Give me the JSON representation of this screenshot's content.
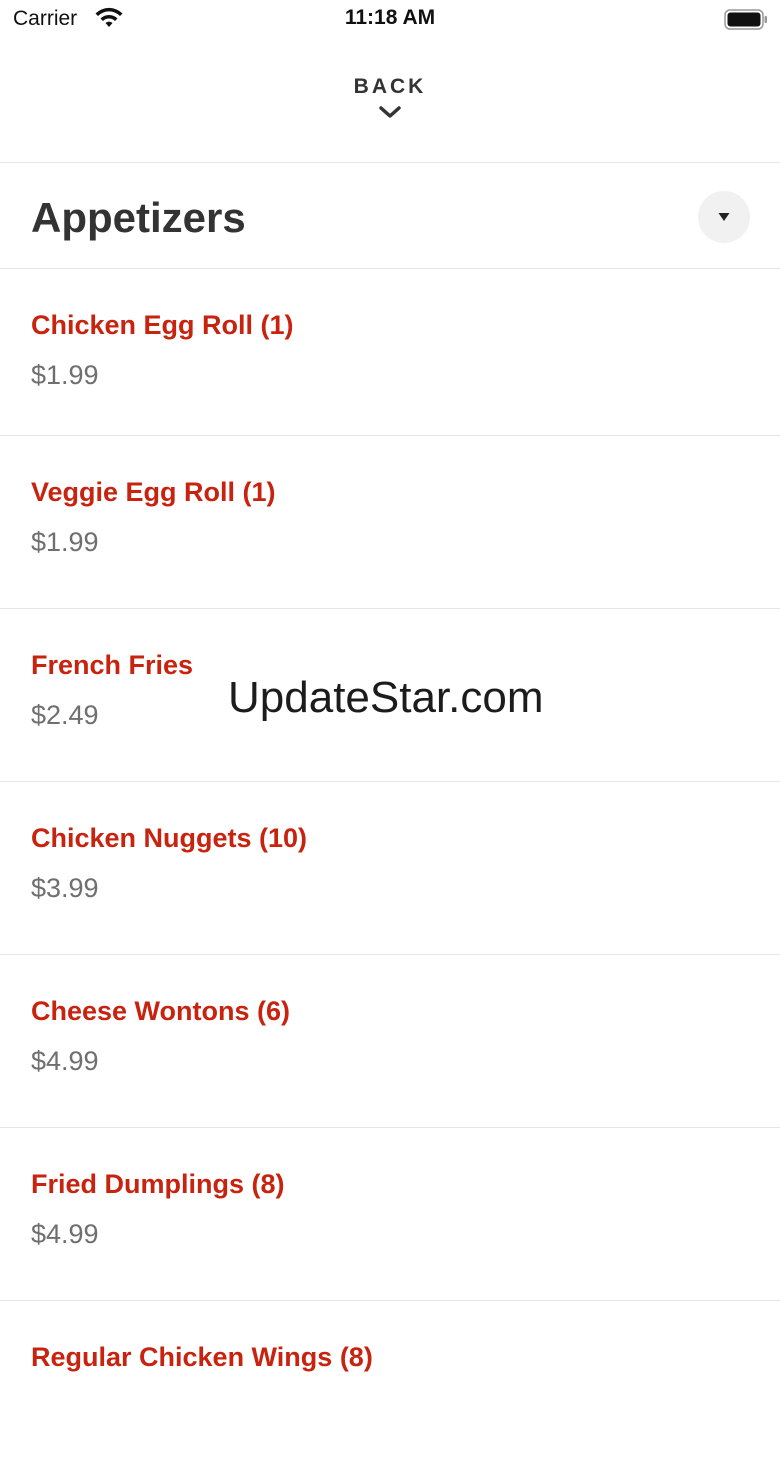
{
  "status_bar": {
    "carrier": "Carrier",
    "time": "11:18 AM"
  },
  "nav": {
    "back_label": "BACK"
  },
  "section": {
    "title": "Appetizers"
  },
  "menu_items": [
    {
      "name": "Chicken Egg Roll (1)",
      "price": "$1.99"
    },
    {
      "name": "Veggie Egg Roll (1)",
      "price": "$1.99"
    },
    {
      "name": "French Fries",
      "price": "$2.49"
    },
    {
      "name": "Chicken Nuggets (10)",
      "price": "$3.99"
    },
    {
      "name": "Cheese Wontons (6)",
      "price": "$4.99"
    },
    {
      "name": "Fried Dumplings (8)",
      "price": "$4.99"
    },
    {
      "name": "Regular Chicken Wings (8)",
      "price": ""
    }
  ],
  "watermark": {
    "text": "UpdateStar.com"
  },
  "colors": {
    "item_name": "#c8230f",
    "price": "#6f6f6f",
    "title": "#333333",
    "divider": "#e6e6e6",
    "toggle_bg": "#f1f1f1"
  },
  "icons": {
    "wifi": "wifi-icon",
    "battery": "battery-icon",
    "back": "chevron-down-icon",
    "toggle": "caret-down-icon"
  }
}
